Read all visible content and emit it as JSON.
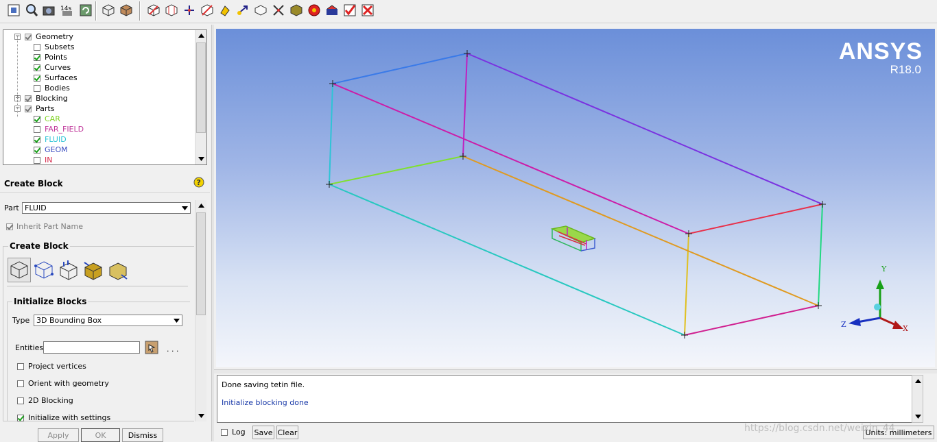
{
  "toolbar": {
    "icons": [
      "fit-window-icon",
      "zoom-box-icon",
      "camera-icon",
      "select-model-icon",
      "undo-icon",
      "wireframe-icon",
      "solid-icon",
      "create-block-icon",
      "split-block-icon",
      "merge-vertices-icon",
      "edit-block-icon",
      "associate-icon",
      "move-vertex-icon",
      "transform-block-icon",
      "edit-edge-icon",
      "pre-mesh-params-icon",
      "pre-mesh-quality-icon",
      "pre-mesh-smooth-icon",
      "block-checks-icon",
      "delete-block-icon"
    ]
  },
  "tree": {
    "items": [
      {
        "label": "Geometry",
        "level": 0,
        "expander": true,
        "check": "grey",
        "color": "#000000"
      },
      {
        "label": "Subsets",
        "level": 1,
        "check": "off",
        "color": "#000000"
      },
      {
        "label": "Points",
        "level": 1,
        "check": "on",
        "color": "#000000"
      },
      {
        "label": "Curves",
        "level": 1,
        "check": "on",
        "color": "#000000"
      },
      {
        "label": "Surfaces",
        "level": 1,
        "check": "on",
        "color": "#000000"
      },
      {
        "label": "Bodies",
        "level": 1,
        "check": "off",
        "color": "#000000"
      },
      {
        "label": "Blocking",
        "level": 0,
        "expander": true,
        "check": "grey",
        "color": "#000000"
      },
      {
        "label": "Parts",
        "level": 0,
        "expander": true,
        "check": "grey",
        "color": "#000000"
      },
      {
        "label": "CAR",
        "level": 1,
        "check": "on",
        "color": "#7ed321"
      },
      {
        "label": "FAR_FIELD",
        "level": 1,
        "check": "off",
        "color": "#c0389b"
      },
      {
        "label": "FLUID",
        "level": 1,
        "check": "on",
        "color": "#2ec4d6"
      },
      {
        "label": "GEOM",
        "level": 1,
        "check": "on",
        "color": "#3a4cc0"
      },
      {
        "label": "IN",
        "level": 1,
        "check": "off",
        "color": "#d6284a"
      }
    ]
  },
  "panel": {
    "title": "Create Block",
    "part_label": "Part",
    "part_value": "FLUID",
    "inherit_label": "Inherit Part Name",
    "create_block_group": "Create Block",
    "init_group": "Initialize Blocks",
    "type_label": "Type",
    "type_value": "3D Bounding Box",
    "entities_label": "Entities",
    "entities_dots": ". . .",
    "options": [
      {
        "label": "Project vertices",
        "checked": false
      },
      {
        "label": "Orient with geometry",
        "checked": false
      },
      {
        "label": "2D Blocking",
        "checked": false
      },
      {
        "label": "Initialize with settings",
        "checked": true
      }
    ],
    "buttons": {
      "apply": "Apply",
      "ok": "OK",
      "dismiss": "Dismiss"
    }
  },
  "viewport": {
    "logo": "ANSYS",
    "version": "R18.0",
    "axis_labels": {
      "x": "X",
      "y": "Y",
      "z": "Z"
    }
  },
  "messages": {
    "lines": [
      "Done saving tetin file.",
      "Initialize blocking done"
    ],
    "log_label": "Log",
    "save_label": "Save",
    "clear_label": "Clear"
  },
  "status": {
    "units": "Units: millimeters"
  },
  "watermark": "https://blog.csdn.net/weixin_44"
}
